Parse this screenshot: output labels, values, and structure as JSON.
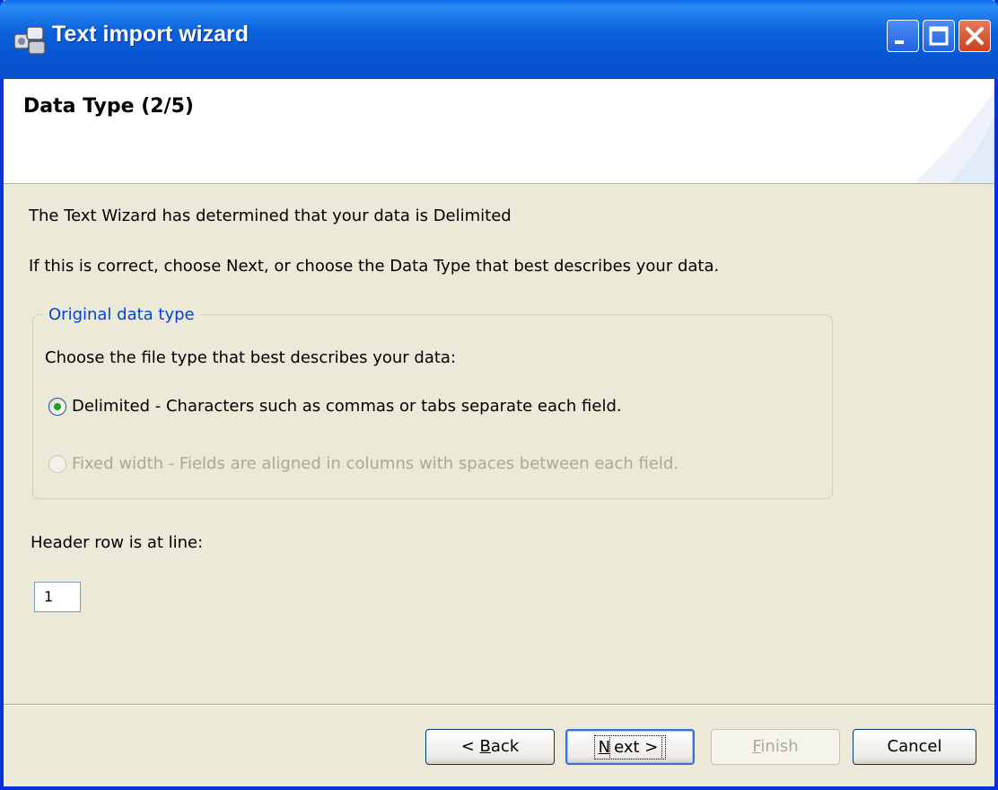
{
  "window": {
    "title": "Text import wizard",
    "icon": "wizard-app-icon"
  },
  "header": {
    "title": "Data Type (2/5)"
  },
  "content": {
    "line1": "The Text Wizard has determined that your data is Delimited",
    "line2": "If this is correct, choose Next, or choose the Data Type that best describes your data.",
    "group": {
      "legend": "Original data type",
      "prompt": "Choose the file type that best describes your data:",
      "options": [
        {
          "label": "Delimited - Characters such as commas or tabs separate each field.",
          "selected": true,
          "enabled": true
        },
        {
          "label": "Fixed width - Fields are aligned in columns with spaces between each field.",
          "selected": false,
          "enabled": false
        }
      ]
    },
    "header_row_label": "Header row is at line:",
    "header_row_value": "1"
  },
  "buttons": {
    "back": {
      "pre": "< ",
      "mnemonic": "B",
      "post": "ack"
    },
    "next": {
      "mnemonic": "N",
      "post": "ext >"
    },
    "finish": {
      "mnemonic": "F",
      "post": "inish"
    },
    "cancel": "Cancel"
  },
  "colors": {
    "titlebar": "#0553d1",
    "legend": "#0046d5",
    "background": "#ece9d8"
  }
}
